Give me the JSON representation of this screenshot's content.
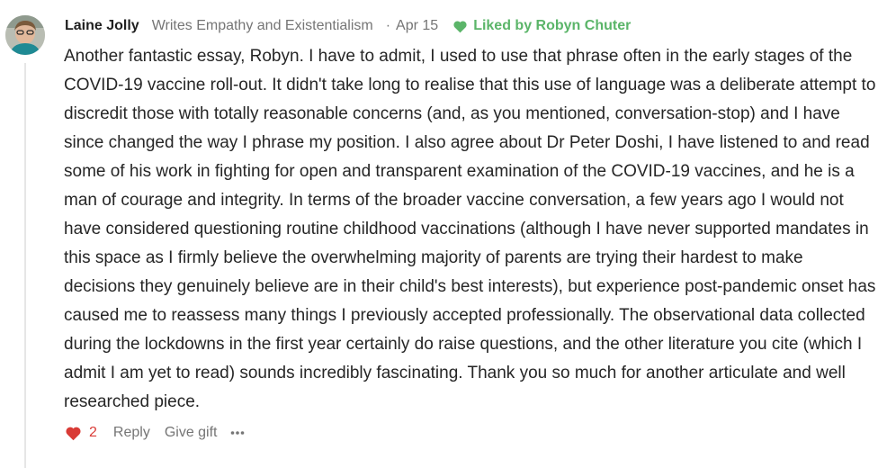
{
  "comment": {
    "author": "Laine Jolly",
    "byline": "Writes Empathy and Existentialism",
    "separator": "·",
    "date": "Apr 15",
    "liked_by": "Liked by Robyn Chuter",
    "body": "Another fantastic essay, Robyn. I have to admit, I used to use that phrase often in the early stages of the COVID-19 vaccine roll-out. It didn't take long to realise that this use of language was a deliberate attempt to discredit those with totally reasonable concerns (and, as you mentioned, conversation-stop) and I have since changed the way I phrase my position. I also agree about Dr Peter Doshi, I have listened to and read some of his work in fighting for open and transparent examination of the COVID-19 vaccines, and he is a man of courage and integrity. In terms of the broader vaccine conversation, a few years ago I would not have considered questioning routine childhood vaccinations (although I have never supported mandates in this space as I firmly believe the overwhelming majority of parents are trying their hardest to make decisions they genuinely believe are in their child's best interests), but experience post-pandemic onset has caused me to reassess many things I previously accepted professionally. The observational data collected during the lockdowns in the first year certainly do raise questions, and the other literature you cite (which I admit I am yet to read) sounds incredibly fascinating. Thank you so much for another articulate and well researched piece.",
    "like_count": "2",
    "reply_label": "Reply",
    "gift_label": "Give gift",
    "more_label": "•••"
  },
  "icons": {
    "avatar": "avatar-photo",
    "liked": "heart-icon",
    "like": "heart-icon",
    "more": "more-icon"
  },
  "colors": {
    "liked_green": "#5bb569",
    "like_red": "#d93b36",
    "meta_gray": "#757575"
  }
}
